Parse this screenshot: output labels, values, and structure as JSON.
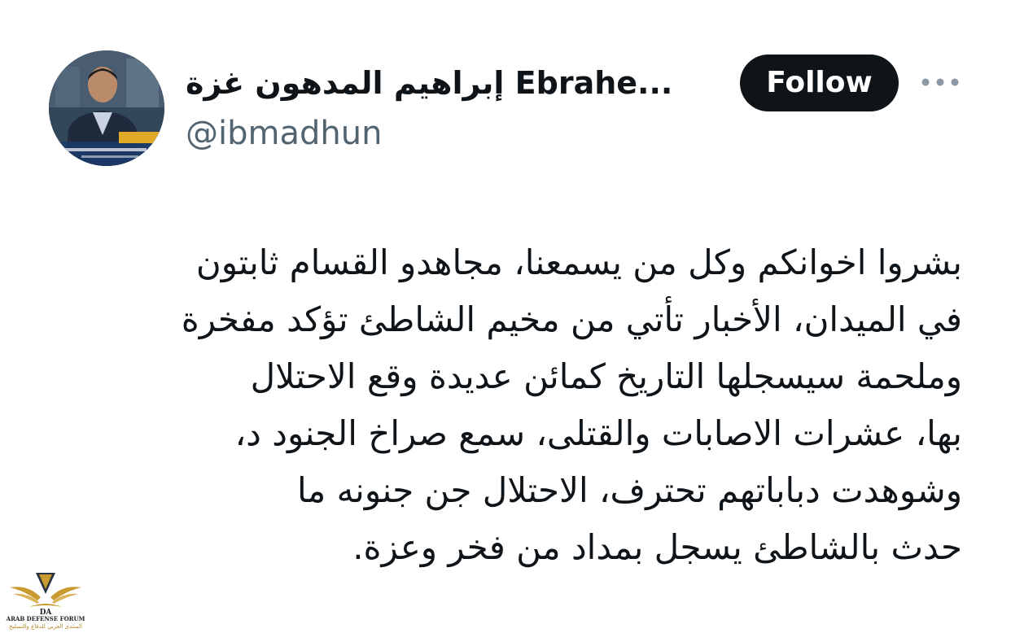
{
  "profile": {
    "display_name": "إبراهيم المدهون غزة Ebrahe...",
    "handle": "@ibmadhun",
    "avatar_icon": "profile-photo"
  },
  "actions": {
    "follow_label": "Follow",
    "more_icon": "more-horizontal-icon"
  },
  "tweet": {
    "lines": [
      "بشروا اخوانكم وكل من يسمعنا،  مجاهدو القسام ثابتون",
      "في الميدان، الأخبار  تأتي من مخيم الشاطئ تؤكد مفخرة",
      "وملحمة سيسجلها التاريخ كمائن عديدة وقع الاحتلال",
      "بها، عشرات الاصابات والقتلى، سمع صراخ الجنود د،",
      "وشوهدت دباباتهم تحترف، الاحتلال جن جنونه  ما",
      "حدث بالشاطئ يسجل بمداد من فخر وعزة."
    ]
  },
  "watermark": {
    "logo_text": "DA",
    "line1": "ARAB DEFENSE FORUM",
    "line2": "المنتدى العربي للدفاع والتسليح"
  },
  "colors": {
    "text_primary": "#0f1419",
    "text_secondary": "#536471",
    "button_bg": "#0f1419",
    "button_text": "#ffffff",
    "watermark_gold": "#c99a2e"
  }
}
